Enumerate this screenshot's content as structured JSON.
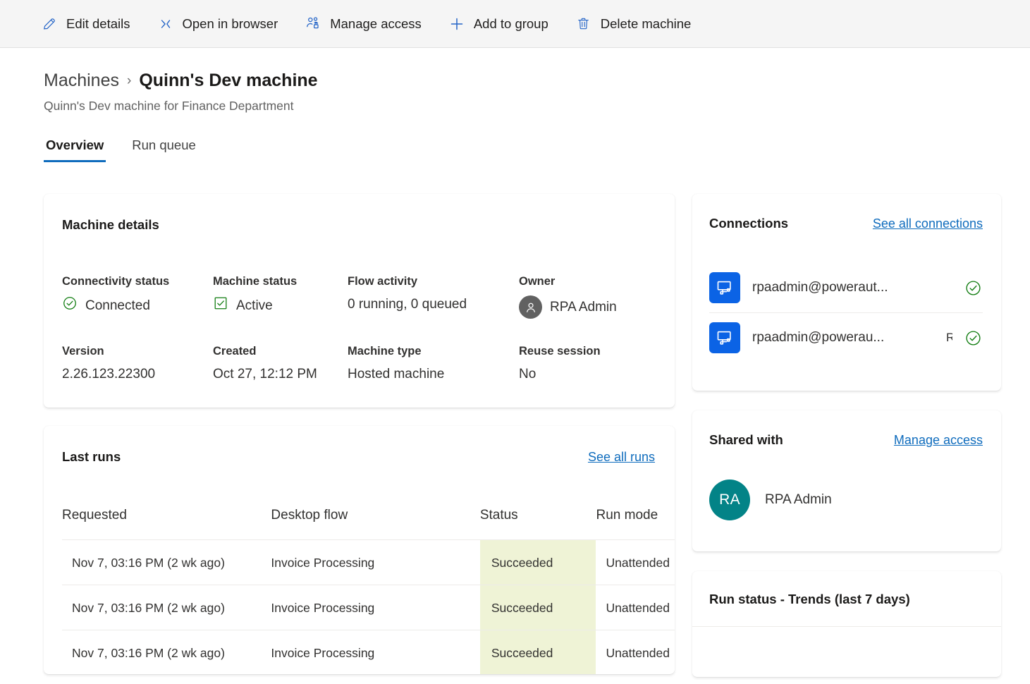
{
  "toolbar": {
    "actions": [
      {
        "label": "Edit details",
        "icon": "pencil-icon"
      },
      {
        "label": "Open in browser",
        "icon": "open-in-browser-icon"
      },
      {
        "label": "Manage access",
        "icon": "people-lock-icon"
      },
      {
        "label": "Add to group",
        "icon": "plus-icon"
      },
      {
        "label": "Delete machine",
        "icon": "trash-icon"
      }
    ]
  },
  "header": {
    "breadcrumb_parent": "Machines",
    "breadcrumb_separator": "›",
    "title": "Quinn's Dev machine",
    "subtitle": "Quinn's Dev machine for Finance Department"
  },
  "tabs": [
    {
      "label": "Overview",
      "active": true
    },
    {
      "label": "Run queue",
      "active": false
    }
  ],
  "machine_details": {
    "title": "Machine details",
    "fields": [
      {
        "label": "Connectivity status",
        "value": "Connected",
        "icon": "green-check-circle-icon"
      },
      {
        "label": "Machine status",
        "value": "Active",
        "icon": "green-check-box-icon"
      },
      {
        "label": "Flow activity",
        "value": "0 running, 0 queued",
        "icon": ""
      },
      {
        "label": "Owner",
        "value": "RPA Admin",
        "icon": "person-avatar-icon"
      },
      {
        "label": "Version",
        "value": "2.26.123.22300",
        "icon": ""
      },
      {
        "label": "Created",
        "value": "Oct 27, 12:12 PM",
        "icon": ""
      },
      {
        "label": "Machine type",
        "value": "Hosted machine",
        "icon": ""
      },
      {
        "label": "Reuse session",
        "value": "No",
        "icon": ""
      }
    ]
  },
  "last_runs": {
    "title": "Last runs",
    "link": "See all runs",
    "columns": [
      "Requested",
      "Desktop flow",
      "Status",
      "Run mode"
    ],
    "rows": [
      {
        "requested": "Nov 7, 03:16 PM (2 wk ago)",
        "flow": "Invoice Processing",
        "status": "Succeeded",
        "run_mode": "Unattended"
      },
      {
        "requested": "Nov 7, 03:16 PM (2 wk ago)",
        "flow": "Invoice Processing",
        "status": "Succeeded",
        "run_mode": "Unattended"
      },
      {
        "requested": "Nov 7, 03:16 PM (2 wk ago)",
        "flow": "Invoice Processing",
        "status": "Succeeded",
        "run_mode": "Unattended"
      }
    ]
  },
  "connections": {
    "title": "Connections",
    "link": "See all connections",
    "items": [
      {
        "name": "rpaadmin@poweraut...",
        "secondary": "",
        "status_icon": "green-check-circle-icon"
      },
      {
        "name": "rpaadmin@powerau...",
        "secondary": "R",
        "status_icon": "green-check-circle-icon"
      }
    ]
  },
  "shared_with": {
    "title": "Shared with",
    "link": "Manage access",
    "people": [
      {
        "initials": "RA",
        "name": "RPA Admin"
      }
    ]
  },
  "run_status_trends": {
    "title": "Run status - Trends (last 7 days)"
  },
  "colors": {
    "accent": "#0f6cbd",
    "link": "#0f6cbd",
    "success_green": "#107c10",
    "status_cell_bg": "#eff3d6",
    "connector_blue": "#0b63e5",
    "avatar_teal": "#038387",
    "toolbar_bg": "#f5f5f5"
  }
}
